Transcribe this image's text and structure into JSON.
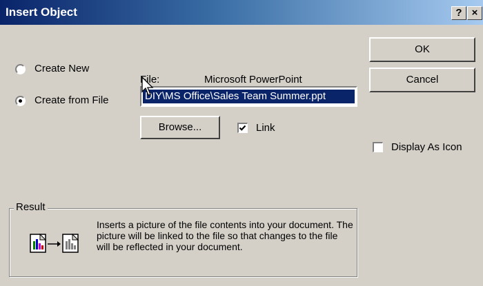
{
  "dialog": {
    "title": "Insert Object",
    "help_glyph": "?",
    "close_glyph": "×"
  },
  "options": {
    "create_new": "Create New",
    "create_from_file": "Create from File",
    "selected": "create_from_file"
  },
  "file": {
    "label": "File:",
    "type_name": "Microsoft PowerPoint",
    "path_value": "DIY\\MS Office\\Sales Team Summer.ppt"
  },
  "buttons": {
    "ok": "OK",
    "cancel": "Cancel",
    "browse": "Browse..."
  },
  "link": {
    "label": "Link",
    "checked": true
  },
  "display_as_icon": {
    "label": "Display As Icon",
    "checked": false
  },
  "result": {
    "title": "Result",
    "description": "Inserts a picture of the file contents into your document.  The picture will be linked to the file so that changes to the file will be reflected in your document."
  },
  "icons": {
    "help": "help-icon",
    "close": "close-icon",
    "result": "linked-picture-icon",
    "cursor": "mouse-pointer-icon"
  },
  "colors": {
    "titlebar_start": "#0a246a",
    "titlebar_end": "#a6caf0",
    "face": "#d4d0c8",
    "selection": "#0a246a"
  }
}
